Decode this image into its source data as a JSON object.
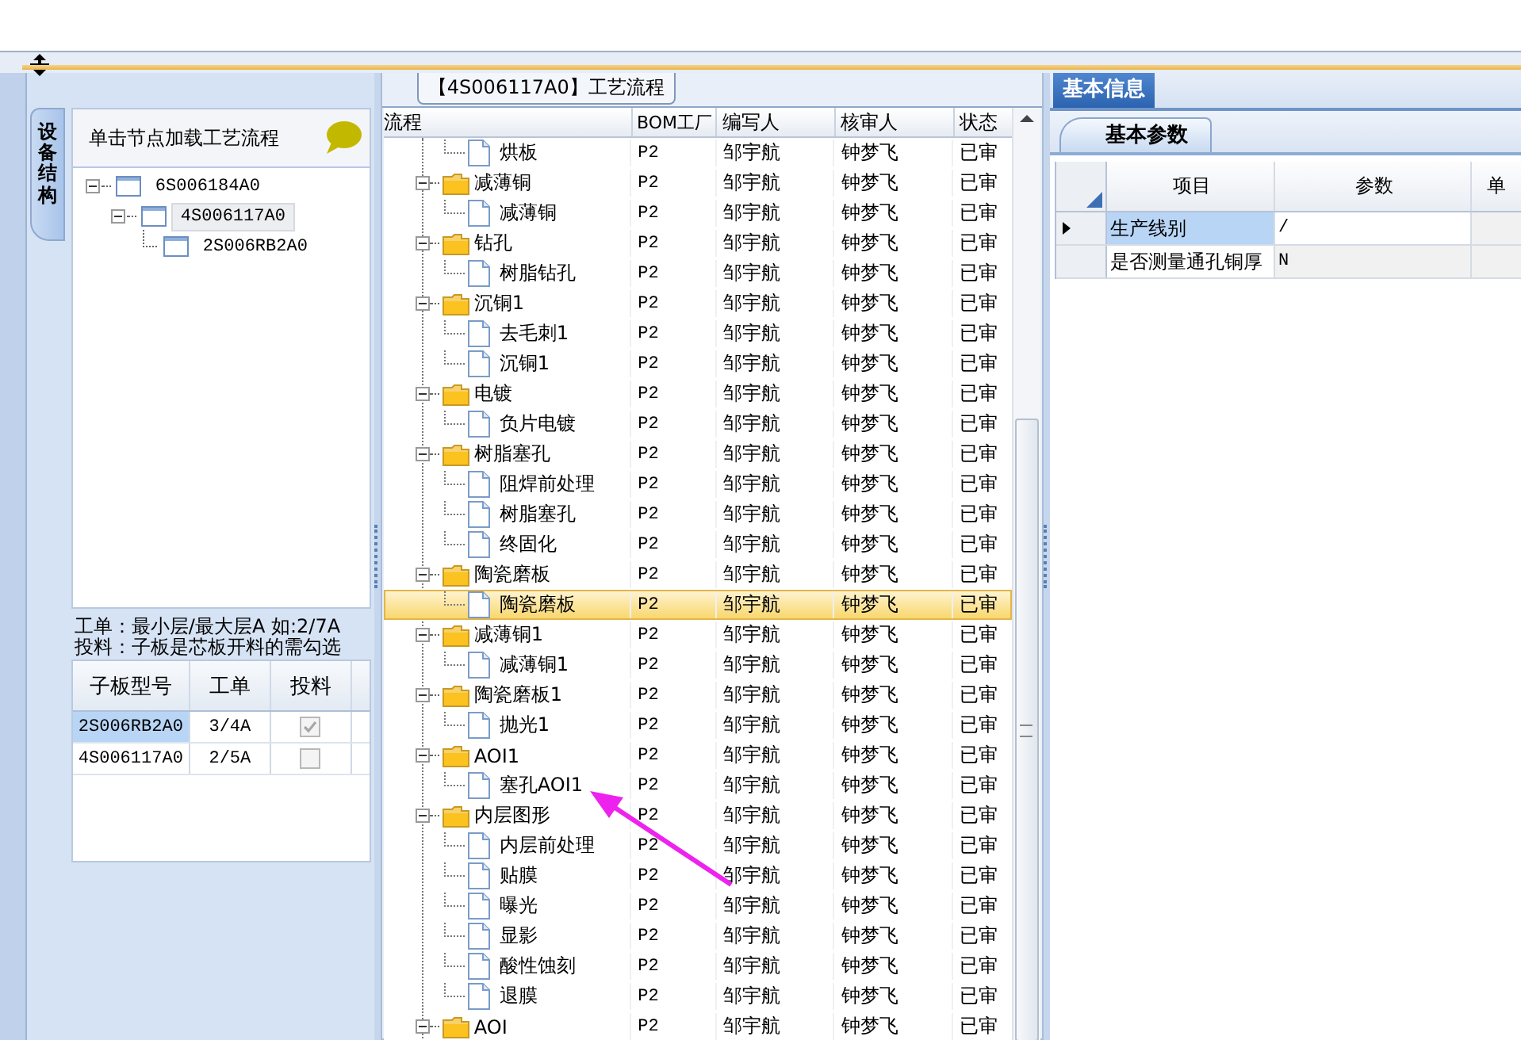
{
  "left_panel": {
    "side_tab": "设备结构",
    "hint": "单击节点加载工艺流程",
    "tree": [
      {
        "label": "6S006184A0",
        "expanded": true,
        "selected": false,
        "children": [
          {
            "label": "4S006117A0",
            "expanded": true,
            "selected": true,
            "children": [
              {
                "label": "2S006RB2A0",
                "selected": false
              }
            ]
          }
        ]
      }
    ],
    "notes": [
      "工单：最小层/最大层A 如:2/7A",
      "投料：子板是芯板开料的需勾选"
    ],
    "board_table": {
      "columns": [
        "子板型号",
        "工单",
        "投料"
      ],
      "rows": [
        {
          "model": "2S006RB2A0",
          "order": "3/4A",
          "checked": true,
          "selected": true
        },
        {
          "model": "4S006117A0",
          "order": "2/5A",
          "checked": false,
          "selected": false
        }
      ]
    }
  },
  "flow_panel": {
    "title": "【4S006117A0】工艺流程",
    "columns": [
      "流程",
      "BOM工厂",
      "编写人",
      "核审人",
      "状态"
    ],
    "rows": [
      {
        "kind": "file",
        "name": "烘板",
        "bom": "P2",
        "writer": "邹宇航",
        "reviewer": "钟梦飞",
        "status": "已审",
        "selected": false
      },
      {
        "kind": "folder",
        "name": "减薄铜",
        "bom": "P2",
        "writer": "邹宇航",
        "reviewer": "钟梦飞",
        "status": "已审",
        "selected": false,
        "expanded": true,
        "children": [
          {
            "kind": "file",
            "name": "减薄铜",
            "bom": "P2",
            "writer": "邹宇航",
            "reviewer": "钟梦飞",
            "status": "已审",
            "selected": false
          }
        ]
      },
      {
        "kind": "folder",
        "name": "钻孔",
        "bom": "P2",
        "writer": "邹宇航",
        "reviewer": "钟梦飞",
        "status": "已审",
        "selected": false,
        "expanded": true,
        "children": [
          {
            "kind": "file",
            "name": "树脂钻孔",
            "bom": "P2",
            "writer": "邹宇航",
            "reviewer": "钟梦飞",
            "status": "已审",
            "selected": false
          }
        ]
      },
      {
        "kind": "folder",
        "name": "沉铜1",
        "bom": "P2",
        "writer": "邹宇航",
        "reviewer": "钟梦飞",
        "status": "已审",
        "selected": false,
        "expanded": true,
        "children": [
          {
            "kind": "file",
            "name": "去毛刺1",
            "bom": "P2",
            "writer": "邹宇航",
            "reviewer": "钟梦飞",
            "status": "已审",
            "selected": false
          },
          {
            "kind": "file",
            "name": "沉铜1",
            "bom": "P2",
            "writer": "邹宇航",
            "reviewer": "钟梦飞",
            "status": "已审",
            "selected": false
          }
        ]
      },
      {
        "kind": "folder",
        "name": "电镀",
        "bom": "P2",
        "writer": "邹宇航",
        "reviewer": "钟梦飞",
        "status": "已审",
        "selected": false,
        "expanded": true,
        "children": [
          {
            "kind": "file",
            "name": "负片电镀",
            "bom": "P2",
            "writer": "邹宇航",
            "reviewer": "钟梦飞",
            "status": "已审",
            "selected": false
          }
        ]
      },
      {
        "kind": "folder",
        "name": "树脂塞孔",
        "bom": "P2",
        "writer": "邹宇航",
        "reviewer": "钟梦飞",
        "status": "已审",
        "selected": false,
        "expanded": true,
        "children": [
          {
            "kind": "file",
            "name": "阻焊前处理",
            "bom": "P2",
            "writer": "邹宇航",
            "reviewer": "钟梦飞",
            "status": "已审",
            "selected": false
          },
          {
            "kind": "file",
            "name": "树脂塞孔",
            "bom": "P2",
            "writer": "邹宇航",
            "reviewer": "钟梦飞",
            "status": "已审",
            "selected": false
          },
          {
            "kind": "file",
            "name": "终固化",
            "bom": "P2",
            "writer": "邹宇航",
            "reviewer": "钟梦飞",
            "status": "已审",
            "selected": false
          }
        ]
      },
      {
        "kind": "folder",
        "name": "陶瓷磨板",
        "bom": "P2",
        "writer": "邹宇航",
        "reviewer": "钟梦飞",
        "status": "已审",
        "selected": false,
        "expanded": true,
        "children": [
          {
            "kind": "file",
            "name": "陶瓷磨板",
            "bom": "P2",
            "writer": "邹宇航",
            "reviewer": "钟梦飞",
            "status": "已审",
            "selected": true
          }
        ]
      },
      {
        "kind": "folder",
        "name": "减薄铜1",
        "bom": "P2",
        "writer": "邹宇航",
        "reviewer": "钟梦飞",
        "status": "已审",
        "selected": false,
        "expanded": true,
        "children": [
          {
            "kind": "file",
            "name": "减薄铜1",
            "bom": "P2",
            "writer": "邹宇航",
            "reviewer": "钟梦飞",
            "status": "已审",
            "selected": false
          }
        ]
      },
      {
        "kind": "folder",
        "name": "陶瓷磨板1",
        "bom": "P2",
        "writer": "邹宇航",
        "reviewer": "钟梦飞",
        "status": "已审",
        "selected": false,
        "expanded": true,
        "children": [
          {
            "kind": "file",
            "name": "抛光1",
            "bom": "P2",
            "writer": "邹宇航",
            "reviewer": "钟梦飞",
            "status": "已审",
            "selected": false
          }
        ]
      },
      {
        "kind": "folder",
        "name": "AOI1",
        "bom": "P2",
        "writer": "邹宇航",
        "reviewer": "钟梦飞",
        "status": "已审",
        "selected": false,
        "expanded": true,
        "children": [
          {
            "kind": "file",
            "name": "塞孔AOI1",
            "bom": "P2",
            "writer": "邹宇航",
            "reviewer": "钟梦飞",
            "status": "已审",
            "selected": false
          }
        ]
      },
      {
        "kind": "folder",
        "name": "内层图形",
        "bom": "P2",
        "writer": "邹宇航",
        "reviewer": "钟梦飞",
        "status": "已审",
        "selected": false,
        "expanded": true,
        "children": [
          {
            "kind": "file",
            "name": "内层前处理",
            "bom": "P2",
            "writer": "邹宇航",
            "reviewer": "钟梦飞",
            "status": "已审",
            "selected": false
          },
          {
            "kind": "file",
            "name": "贴膜",
            "bom": "P2",
            "writer": "邹宇航",
            "reviewer": "钟梦飞",
            "status": "已审",
            "selected": false
          },
          {
            "kind": "file",
            "name": "曝光",
            "bom": "P2",
            "writer": "邹宇航",
            "reviewer": "钟梦飞",
            "status": "已审",
            "selected": false
          },
          {
            "kind": "file",
            "name": "显影",
            "bom": "P2",
            "writer": "邹宇航",
            "reviewer": "钟梦飞",
            "status": "已审",
            "selected": false
          },
          {
            "kind": "file",
            "name": "酸性蚀刻",
            "bom": "P2",
            "writer": "邹宇航",
            "reviewer": "钟梦飞",
            "status": "已审",
            "selected": false
          },
          {
            "kind": "file",
            "name": "退膜",
            "bom": "P2",
            "writer": "邹宇航",
            "reviewer": "钟梦飞",
            "status": "已审",
            "selected": false
          }
        ]
      },
      {
        "kind": "folder",
        "name": "AOI",
        "bom": "P2",
        "writer": "邹宇航",
        "reviewer": "钟梦飞",
        "status": "已审",
        "selected": false,
        "expanded": true
      }
    ]
  },
  "info_panel": {
    "tab": "基本信息",
    "subtab": "基本参数",
    "columns": [
      "项目",
      "参数",
      "单"
    ],
    "rows": [
      {
        "item": "生产线别",
        "value": "/",
        "selected": true
      },
      {
        "item": "是否测量通孔铜厚",
        "value": "N",
        "selected": false
      }
    ]
  }
}
